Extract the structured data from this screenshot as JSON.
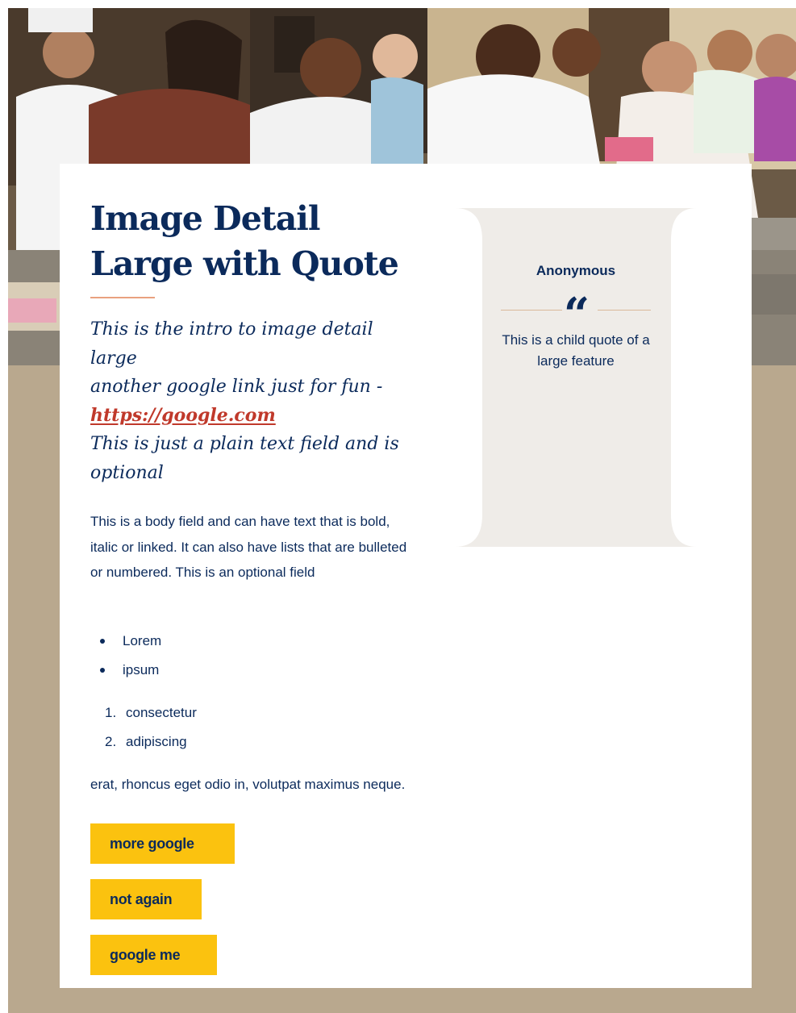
{
  "hero": {
    "image_icon": "photo-icon"
  },
  "feature": {
    "title_line_1": "Image Detail",
    "title_line_2": "Large with Quote",
    "intro": {
      "line_1": "This is the intro to image detail large",
      "line_2": "another google link just for fun -",
      "link_text": "https://google.com",
      "line_3": "This is just a plain text field and is optional"
    },
    "body": "This is a body field and can have text that is bold, italic or linked. It can also have lists that are bulleted or numbered. This is an optional field",
    "bullets": [
      "Lorem",
      "ipsum"
    ],
    "numbered": [
      {
        "num": "1.",
        "text": "consectetur"
      },
      {
        "num": "2.",
        "text": "adipiscing"
      }
    ],
    "tail": "erat, rhoncus eget odio in, volutpat maximus neque.",
    "buttons": [
      "more google",
      "not again",
      "google me"
    ]
  },
  "quote": {
    "author": "Anonymous",
    "mark": "“",
    "icon": "quote-icon",
    "text": "This is a child quote of a large feature"
  },
  "colors": {
    "navy": "#0b2a5b",
    "accent_orange": "#e9a17f",
    "link_red": "#c0392b",
    "button_yellow": "#fbc20f",
    "page_tan": "#b9a88e",
    "quote_panel": "#efece8"
  }
}
